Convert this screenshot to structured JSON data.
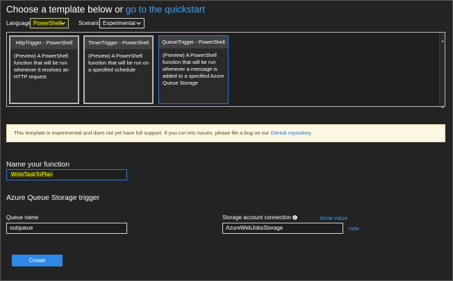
{
  "header": {
    "text": "Choose a template below or",
    "link": "go to the quickstart"
  },
  "filters": {
    "language_label": "Language:",
    "language_value": "PowerShell",
    "scenario_label": "Scenario:",
    "scenario_value": "Experimental"
  },
  "templates": [
    {
      "title": "HttpTrigger - PowerShell",
      "description": "(Preview) A PowerShell function that will be run whenever it receives an HTTP request"
    },
    {
      "title": "TimerTrigger - PowerShell",
      "description": "(Preview) A PowerShell function that will be run on a specified schedule"
    },
    {
      "title": "QueueTrigger - PowerShell",
      "description": "(Preview) A PowerShell function that will be run whenever a message is added to a specified Azure Queue Storage",
      "selected": true
    }
  ],
  "banner": {
    "text": "This template is experimental and does not yet have full support. If you run into issues, please file a bug on our",
    "link": "GitHub repository",
    "suffix": "."
  },
  "name_section": {
    "label": "Name your function",
    "value": "WriteTaskToPlan"
  },
  "trigger_section": {
    "title": "Azure Queue Storage trigger",
    "queue_label": "Queue name",
    "queue_value": "outqueue",
    "storage_label": "Storage account connection",
    "storage_value": "AzureWebJobsStorage",
    "show_value": "show value",
    "new_link": "new"
  },
  "actions": {
    "create_label": "Create"
  },
  "colors": {
    "background": "#232323",
    "accent": "#2d88e6",
    "link": "#3aa0f3",
    "highlight": "#ffff00",
    "banner_bg": "#fcf8e3"
  },
  "icons": {
    "dropdown": "chevron-down-icon",
    "info": "info-icon"
  }
}
